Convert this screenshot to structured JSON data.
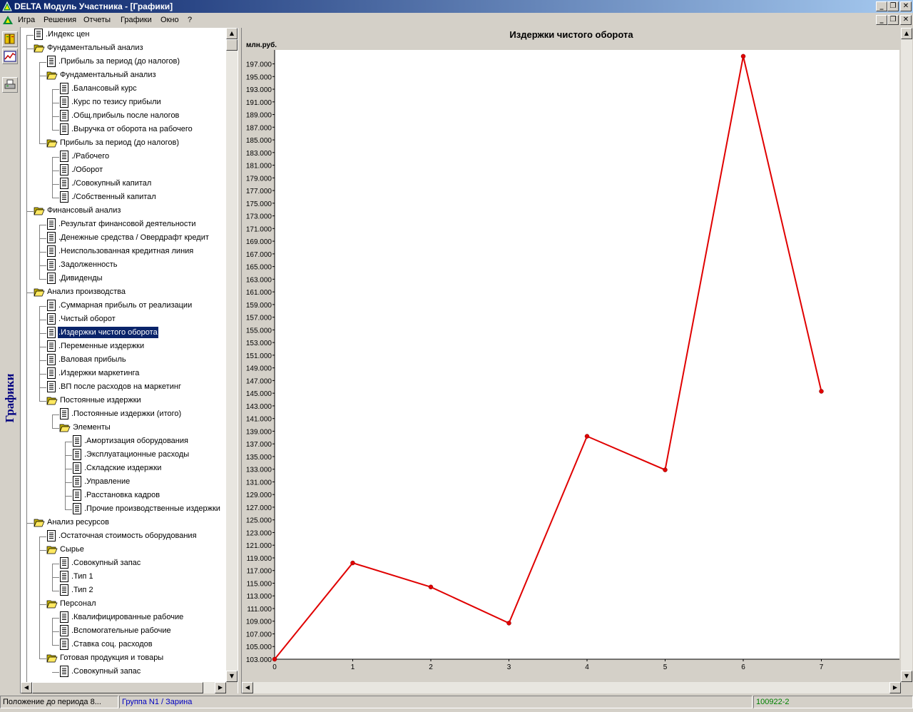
{
  "window": {
    "title": "DELTA Модуль Участника - [Графики]"
  },
  "menu": [
    {
      "label": "Игра"
    },
    {
      "label": "Решения"
    },
    {
      "label": "Отчеты"
    },
    {
      "label": "Графики"
    },
    {
      "label": "Окно"
    },
    {
      "label": "?"
    }
  ],
  "sidebar": {
    "label": "Графики"
  },
  "tree": [
    {
      "label": ".Индекс цен",
      "type": "doc",
      "level": 0
    },
    {
      "label": "Фундаментальный анализ",
      "type": "folder",
      "level": 0
    },
    {
      "label": ".Прибыль за период (до налогов)",
      "type": "doc",
      "level": 1
    },
    {
      "label": "Фундаментальный анализ",
      "type": "folder",
      "level": 1
    },
    {
      "label": ".Балансовый курс",
      "type": "doc",
      "level": 2
    },
    {
      "label": ".Курс по тезису прибыли",
      "type": "doc",
      "level": 2
    },
    {
      "label": ".Общ.прибыль после налогов",
      "type": "doc",
      "level": 2
    },
    {
      "label": ".Выручка от оборота на рабочего",
      "type": "doc",
      "level": 2
    },
    {
      "label": "Прибыль за период (до налогов)",
      "type": "folder",
      "level": 1
    },
    {
      "label": "./Рабочего",
      "type": "doc",
      "level": 2
    },
    {
      "label": "./Оборот",
      "type": "doc",
      "level": 2
    },
    {
      "label": "./Совокупный капитал",
      "type": "doc",
      "level": 2
    },
    {
      "label": "./Собственный капитал",
      "type": "doc",
      "level": 2
    },
    {
      "label": "Финансовый анализ",
      "type": "folder",
      "level": 0
    },
    {
      "label": ".Результат финансовой деятельности",
      "type": "doc",
      "level": 1
    },
    {
      "label": ".Денежные средства / Овердрафт кредит",
      "type": "doc",
      "level": 1
    },
    {
      "label": ".Неиспользованная кредитная линия",
      "type": "doc",
      "level": 1
    },
    {
      "label": ".Задолженность",
      "type": "doc",
      "level": 1
    },
    {
      "label": ".Дивиденды",
      "type": "doc",
      "level": 1
    },
    {
      "label": "Анализ производства",
      "type": "folder",
      "level": 0
    },
    {
      "label": ".Суммарная прибыль от реализации",
      "type": "doc",
      "level": 1
    },
    {
      "label": ".Чистый оборот",
      "type": "doc",
      "level": 1
    },
    {
      "label": ".Издержки чистого оборота",
      "type": "doc",
      "level": 1,
      "selected": true
    },
    {
      "label": ".Переменные издержки",
      "type": "doc",
      "level": 1
    },
    {
      "label": ".Валовая прибыль",
      "type": "doc",
      "level": 1
    },
    {
      "label": ".Издержки маркетинга",
      "type": "doc",
      "level": 1
    },
    {
      "label": ".ВП после расходов на маркетинг",
      "type": "doc",
      "level": 1
    },
    {
      "label": "Постоянные издержки",
      "type": "folder",
      "level": 1
    },
    {
      "label": ".Постоянные издержки (итого)",
      "type": "doc",
      "level": 2
    },
    {
      "label": "Элементы",
      "type": "folder",
      "level": 2
    },
    {
      "label": ".Амортизация оборудования",
      "type": "doc",
      "level": 3
    },
    {
      "label": ".Эксплуатационные расходы",
      "type": "doc",
      "level": 3
    },
    {
      "label": ".Складские издержки",
      "type": "doc",
      "level": 3
    },
    {
      "label": ".Управление",
      "type": "doc",
      "level": 3
    },
    {
      "label": ".Расстановка кадров",
      "type": "doc",
      "level": 3
    },
    {
      "label": ".Прочие производственные издержки",
      "type": "doc",
      "level": 3
    },
    {
      "label": "Анализ ресурсов",
      "type": "folder",
      "level": 0
    },
    {
      "label": ".Остаточная стоимость оборудования",
      "type": "doc",
      "level": 1
    },
    {
      "label": "Сырье",
      "type": "folder",
      "level": 1
    },
    {
      "label": ".Совокупный запас",
      "type": "doc",
      "level": 2
    },
    {
      "label": ".Тип 1",
      "type": "doc",
      "level": 2
    },
    {
      "label": ".Тип 2",
      "type": "doc",
      "level": 2
    },
    {
      "label": "Персонал",
      "type": "folder",
      "level": 1
    },
    {
      "label": ".Квалифицированные рабочие",
      "type": "doc",
      "level": 2
    },
    {
      "label": ".Вспомогательные рабочие",
      "type": "doc",
      "level": 2
    },
    {
      "label": ".Ставка соц. расходов",
      "type": "doc",
      "level": 2
    },
    {
      "label": "Готовая продукция и товары",
      "type": "folder",
      "level": 1
    },
    {
      "label": ".Совокупный запас",
      "type": "doc",
      "level": 2
    }
  ],
  "chart": {
    "title": "Издержки чистого оборота",
    "unit": "млн.руб."
  },
  "chart_data": {
    "type": "line",
    "title": "Издержки чистого оборота",
    "ylabel": "млн.руб.",
    "xlabel": "",
    "x": [
      0,
      1,
      2,
      3,
      4,
      5,
      6,
      7
    ],
    "values": [
      103.0,
      118.2,
      114.4,
      108.7,
      138.2,
      132.9,
      198.2,
      145.3
    ],
    "xlim": [
      0,
      8
    ],
    "ylim": [
      103.0,
      199.2
    ],
    "yticks": [
      103,
      105,
      107,
      109,
      111,
      113,
      115,
      117,
      119,
      121,
      123,
      125,
      127,
      129,
      131,
      133,
      135,
      137,
      139,
      141,
      143,
      145,
      147,
      149,
      151,
      153,
      155,
      157,
      159,
      161,
      163,
      165,
      167,
      169,
      171,
      173,
      175,
      177,
      179,
      181,
      183,
      185,
      187,
      189,
      191,
      193,
      195,
      197
    ],
    "ytick_labels": [
      "103.000",
      "105.000",
      "107.000",
      "109.000",
      "111.000",
      "113.000",
      "115.000",
      "117.000",
      "119.000",
      "121.000",
      "123.000",
      "125.000",
      "127.000",
      "129.000",
      "131.000",
      "133.000",
      "135.000",
      "137.000",
      "139.000",
      "141.000",
      "143.000",
      "145.000",
      "147.000",
      "149.000",
      "151.000",
      "153.000",
      "155.000",
      "157.000",
      "159.000",
      "161.000",
      "163.000",
      "165.000",
      "167.000",
      "169.000",
      "171.000",
      "173.000",
      "175.000",
      "177.000",
      "179.000",
      "181.000",
      "183.000",
      "185.000",
      "187.000",
      "189.000",
      "191.000",
      "193.000",
      "195.000",
      "197.000"
    ],
    "xtick_labels": [
      "0",
      "1",
      "2",
      "3",
      "4",
      "5",
      "6",
      "7"
    ],
    "grid": false,
    "line_color": "#e00000"
  },
  "status": {
    "left": "Положение до периода 8...",
    "group": "Группа N1 / Зарина",
    "code": "100922-2"
  },
  "colors": {
    "title_start": "#0a246a",
    "title_end": "#a6caf0",
    "selection": "#0a246a",
    "group_text": "#0000c0",
    "code_text": "#008000"
  }
}
